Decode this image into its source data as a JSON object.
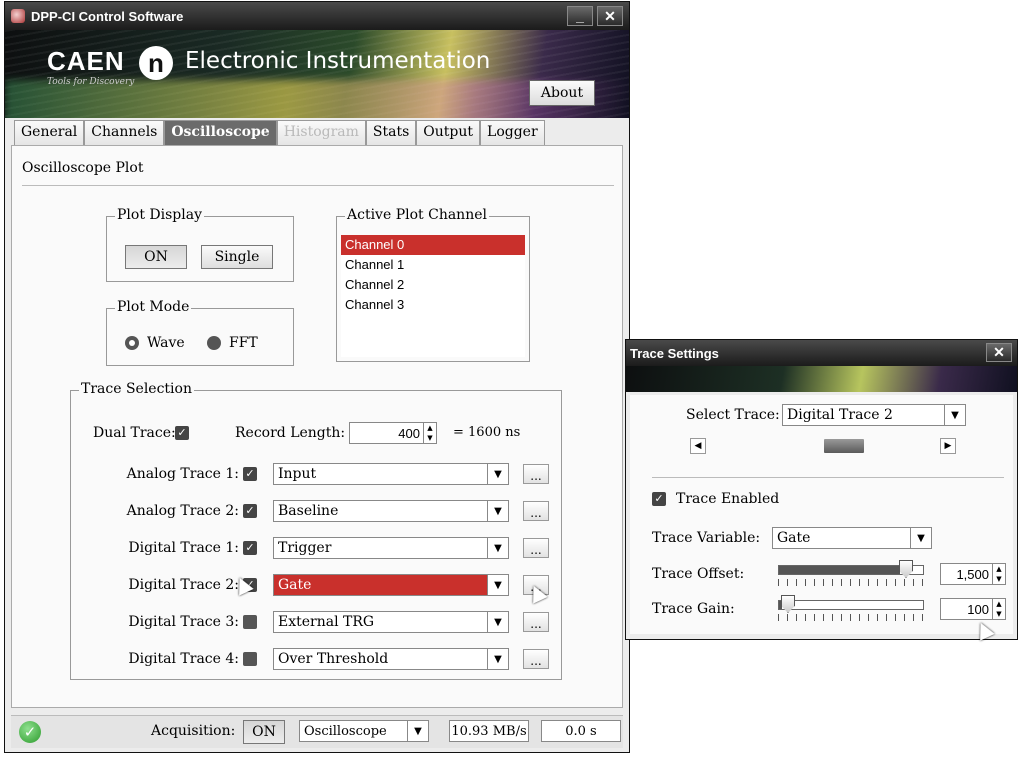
{
  "main_window": {
    "title": "DPP-CI Control Software",
    "minimize_label": "_",
    "close_label": "✕",
    "banner": {
      "brand": "CAEN",
      "tagline": "Tools for Discovery",
      "logo_letter": "n",
      "title": "Electronic Instrumentation",
      "about_label": "About"
    },
    "tabs": [
      {
        "label": "General",
        "state": "normal"
      },
      {
        "label": "Channels",
        "state": "normal"
      },
      {
        "label": "Oscilloscope",
        "state": "active"
      },
      {
        "label": "Histogram",
        "state": "disabled"
      },
      {
        "label": "Stats",
        "state": "normal"
      },
      {
        "label": "Output",
        "state": "normal"
      },
      {
        "label": "Logger",
        "state": "normal"
      }
    ],
    "section_title": "Oscilloscope Plot",
    "plot_display": {
      "title": "Plot Display",
      "on_label": "ON",
      "single_label": "Single"
    },
    "plot_mode": {
      "title": "Plot Mode",
      "wave_label": "Wave",
      "fft_label": "FFT",
      "selected": "Wave"
    },
    "active_plot_channel": {
      "title": "Active Plot  Channel",
      "items": [
        "Channel 0",
        "Channel 1",
        "Channel 2",
        "Channel 3"
      ],
      "selected": "Channel 0"
    },
    "trace_selection": {
      "title": "Trace Selection",
      "dual_trace_label": "Dual Trace:",
      "dual_trace_checked": true,
      "record_length_label": "Record Length:",
      "record_length_value": "400",
      "record_length_ns": "= 1600 ns",
      "dots_label": "...",
      "traces": [
        {
          "label": "Analog Trace 1:",
          "checked": true,
          "value": "Input",
          "highlighted": false
        },
        {
          "label": "Analog Trace 2:",
          "checked": true,
          "value": "Baseline",
          "highlighted": false
        },
        {
          "label": "Digital Trace 1:",
          "checked": true,
          "value": "Trigger",
          "highlighted": false
        },
        {
          "label": "Digital Trace 2:",
          "checked": true,
          "value": "Gate",
          "highlighted": true
        },
        {
          "label": "Digital Trace 3:",
          "checked": false,
          "value": "External TRG",
          "highlighted": false
        },
        {
          "label": "Digital Trace 4:",
          "checked": false,
          "value": "Over Threshold",
          "highlighted": false
        }
      ]
    },
    "status_bar": {
      "acquisition_label": "Acquisition:",
      "acquisition_button": "ON",
      "mode_value": "Oscilloscope",
      "rate_value": "10.93 MB/s",
      "time_value": "0.0 s"
    }
  },
  "trace_window": {
    "title": "Trace Settings",
    "close_label": "✕",
    "select_trace_label": "Select Trace:",
    "select_trace_value": "Digital Trace 2",
    "trace_enabled_label": "Trace Enabled",
    "trace_enabled_checked": true,
    "trace_variable_label": "Trace Variable:",
    "trace_variable_value": "Gate",
    "trace_offset_label": "Trace Offset:",
    "trace_offset_value": "1,500",
    "trace_offset_fraction": 0.92,
    "trace_gain_label": "Trace Gain:",
    "trace_gain_value": "100",
    "trace_gain_fraction": 0.02
  },
  "colors": {
    "selection_red": "#c9302c",
    "title_bar": "#2a2a2a",
    "status_ok_green": "#2b9a2b"
  }
}
